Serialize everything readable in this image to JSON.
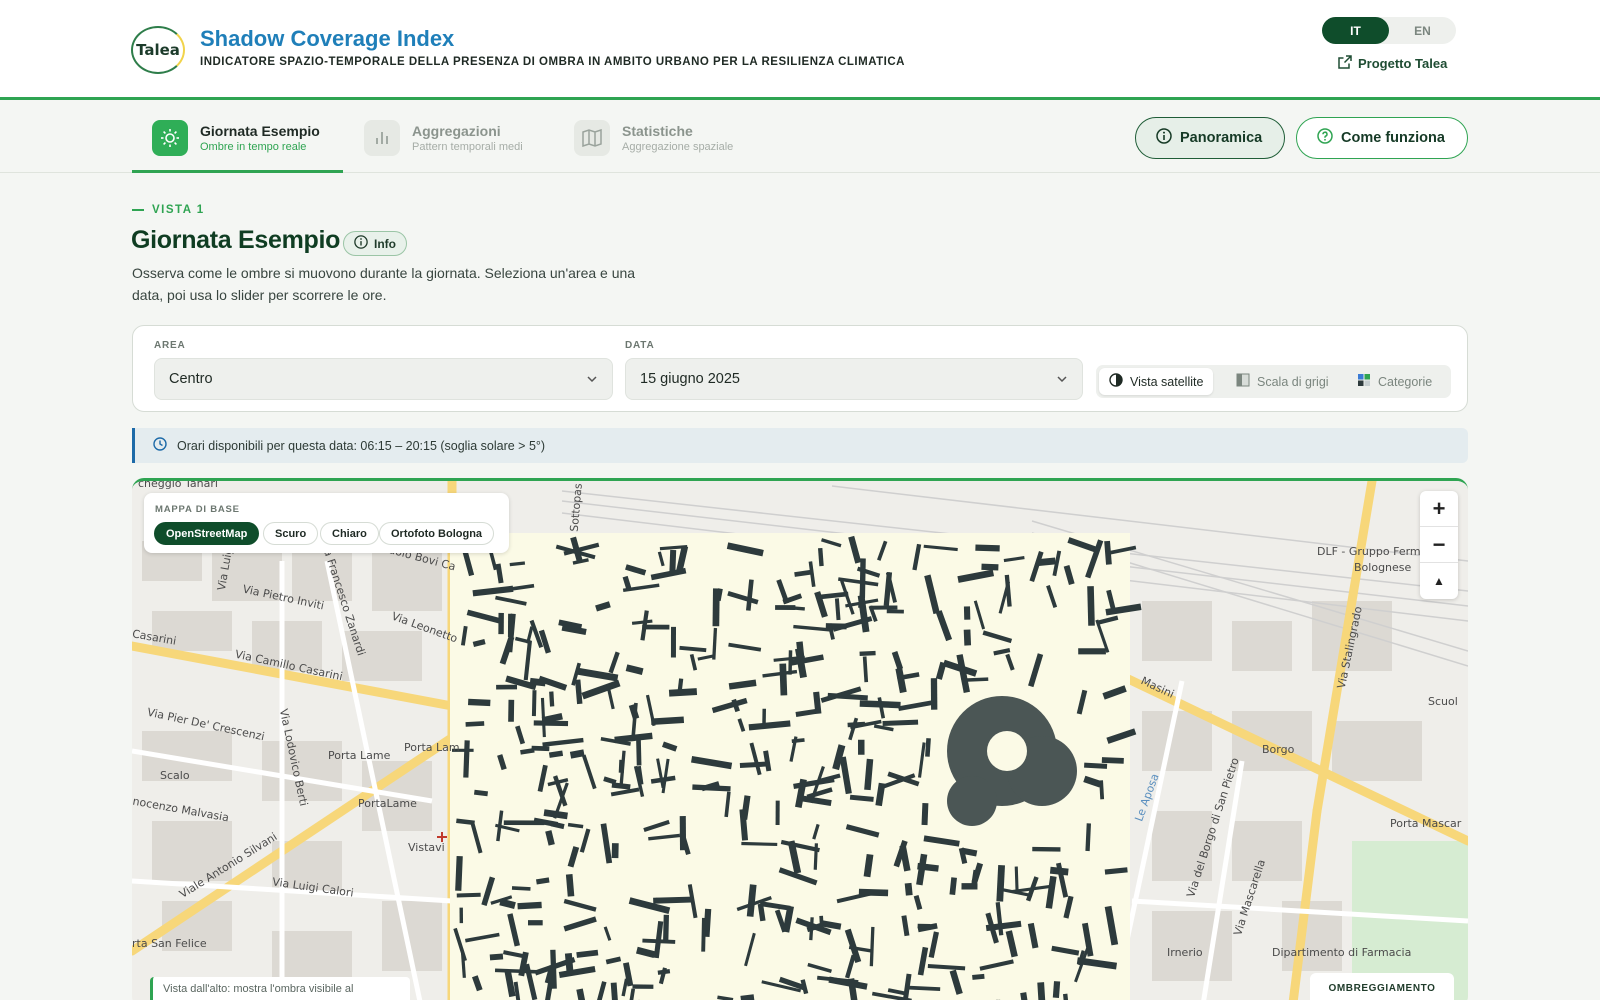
{
  "header": {
    "logo_text": "Talea",
    "title": "Shadow Coverage Index",
    "subtitle": "INDICATORE SPAZIO-TEMPORALE DELLA PRESENZA DI OMBRA IN AMBITO URBANO PER LA RESILIENZA CLIMATICA",
    "lang_options": [
      "IT",
      "EN"
    ],
    "lang_selected": "IT",
    "project_link": "Progetto Talea"
  },
  "nav": {
    "tabs": [
      {
        "label": "Giornata Esempio",
        "sub": "Ombre in tempo reale",
        "icon": "sun-icon",
        "active": true
      },
      {
        "label": "Aggregazioni",
        "sub": "Pattern temporali medi",
        "icon": "bar-chart-icon",
        "active": false
      },
      {
        "label": "Statistiche",
        "sub": "Aggregazione spaziale",
        "icon": "map-icon",
        "active": false
      }
    ],
    "panoramica": "Panoramica",
    "come_funziona": "Come funziona"
  },
  "section": {
    "eyebrow": "VISTA 1",
    "title": "Giornata Esempio",
    "info": "Info",
    "description": "Osserva come le ombre si muovono durante la giornata. Seleziona un'area e una data, poi usa lo slider per scorrere le ore."
  },
  "controls": {
    "area_label": "AREA",
    "area_value": "Centro",
    "date_label": "DATA",
    "date_value": "15 giugno 2025",
    "views": [
      "Vista satellite",
      "Scala di grigi",
      "Categorie"
    ],
    "view_selected": "Vista satellite"
  },
  "hours_note": "Orari disponibili per questa data: 06:15 – 20:15 (soglia solare > 5°)",
  "map": {
    "basemap_label": "MAPPA DI BASE",
    "basemaps": [
      "OpenStreetMap",
      "Scuro",
      "Chiaro",
      "Ortofoto Bologna"
    ],
    "basemap_selected": "OpenStreetMap",
    "zoom_in": "+",
    "zoom_out": "−",
    "reset_north": "▲",
    "legend_title": "OMBREGGIAMENTO",
    "caption": "Vista dall'alto: mostra l'ombra visibile al",
    "street_labels": [
      "cheggio Tanari",
      "Via Pietro Inviti",
      "Via Luigi",
      "Via Francesco Zanardi",
      "Via Leonetto",
      "Paolo Bovi Ca",
      "Sottopas",
      "Casarini",
      "Via Camillo Casarini",
      "Via Pier De' Crescenzi",
      "Via Lodovico Berti",
      "Porta Lame",
      "Porta Lam",
      "Scalo",
      "PortaLame",
      "nocenzo Malvasia",
      "Vistavi",
      "Viale Antonio Silvani",
      "Via Luigi Calori",
      "rta San Felice",
      "DLF - Gruppo Fermo",
      "Bolognese",
      "Via Stalingrado",
      "Masini",
      "Scuol",
      "Borgo",
      "Via del Borgo di San Pietro",
      "Porta Mascar",
      "Via Mascarella",
      "Irnerio",
      "Dipartimento di Farmacia",
      "Le Aposa"
    ]
  },
  "colors": {
    "brand_green": "#2fa452",
    "dark_green": "#0f4d2b",
    "title_blue": "#1f7fb9",
    "shadow": "#2d3a3c",
    "sunlit": "#fbfae6"
  }
}
